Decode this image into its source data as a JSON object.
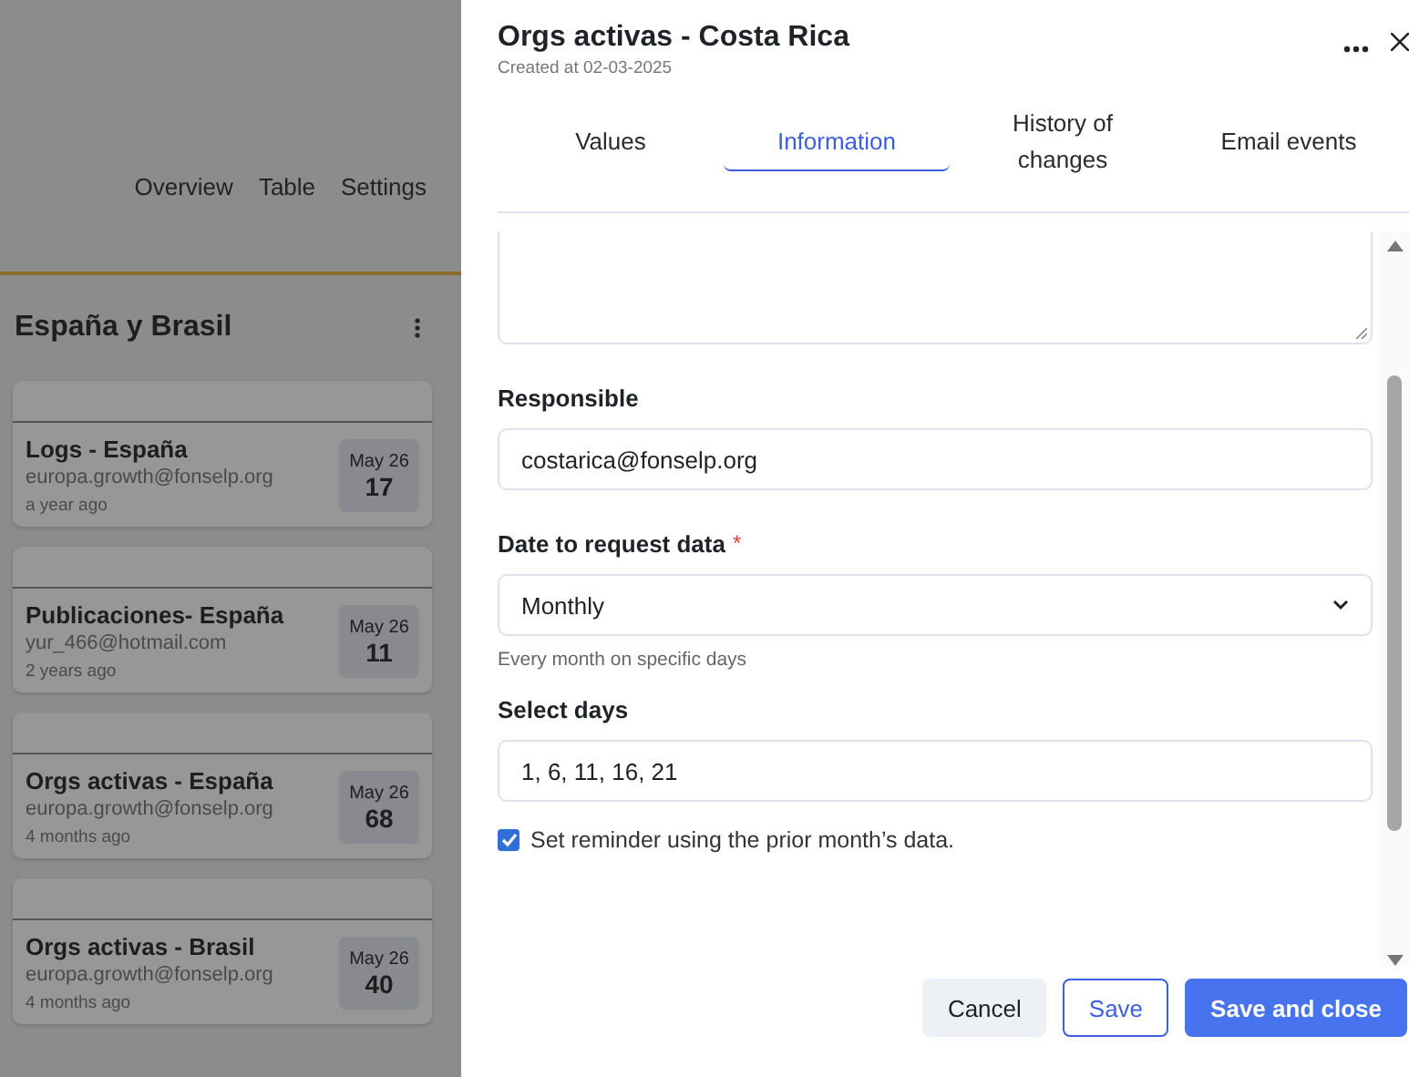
{
  "nav": [
    {
      "label": "Overview"
    },
    {
      "label": "Table"
    },
    {
      "label": "Settings"
    }
  ],
  "board": {
    "title": "España y Brasil",
    "cards": [
      {
        "title": "Logs - España",
        "email": "europa.growth@fonselp.org",
        "time": "a year ago",
        "month": "May 26",
        "day": "17"
      },
      {
        "title": "Publicaciones- España",
        "email": "yur_466@hotmail.com",
        "time": "2 years ago",
        "month": "May 26",
        "day": "11"
      },
      {
        "title": "Orgs activas - España",
        "email": "europa.growth@fonselp.org",
        "time": "4 months ago",
        "month": "May 26",
        "day": "68"
      },
      {
        "title": "Orgs activas - Brasil",
        "email": "europa.growth@fonselp.org",
        "time": "4 months ago",
        "month": "May 26",
        "day": "40"
      }
    ]
  },
  "panel": {
    "title": "Orgs activas - Costa Rica",
    "created": "Created at 02-03-2025",
    "tabs": [
      {
        "label": "Values",
        "selected": false
      },
      {
        "label": "Information",
        "selected": true
      },
      {
        "label": "History of changes",
        "selected": false
      },
      {
        "label": "Email events",
        "selected": false
      }
    ],
    "fields": [
      {
        "kind": "textarea"
      },
      {
        "kind": "text",
        "label": "Responsible",
        "value": "costarica@fonselp.org"
      },
      {
        "kind": "select",
        "label": "Date to request data",
        "required_mark": "*",
        "value": "Monthly",
        "hint": "Every month on specific days"
      },
      {
        "kind": "text",
        "label": "Select days",
        "value": "1, 6, 11, 16, 21"
      },
      {
        "kind": "checkbox",
        "label": "Set reminder using the prior month’s data.",
        "checked": true
      }
    ],
    "buttons": [
      {
        "label": "Cancel",
        "kind": "secondary"
      },
      {
        "label": "Save",
        "kind": "outline"
      },
      {
        "label": "Save and close",
        "kind": "primary"
      }
    ]
  }
}
